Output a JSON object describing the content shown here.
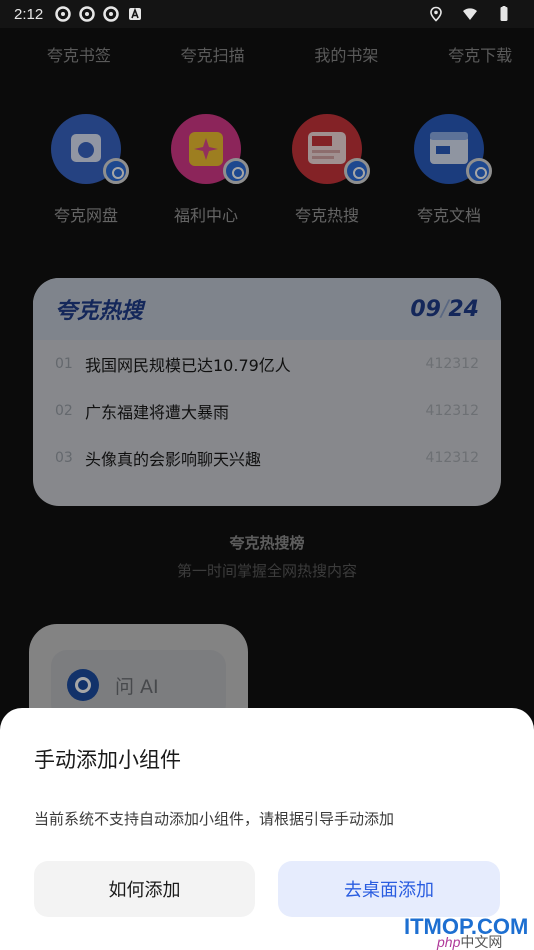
{
  "status_bar": {
    "time": "2:12"
  },
  "top_row": [
    "夸克书签",
    "夸克扫描",
    "我的书架",
    "夸克下载"
  ],
  "apps": [
    {
      "label": "夸克网盘",
      "icon": "cloud-drive-icon",
      "color": "#3a66c6"
    },
    {
      "label": "福利中心",
      "icon": "gift-star-icon",
      "color": "#d83a8a"
    },
    {
      "label": "夸克热搜",
      "icon": "hot-search-icon",
      "color": "#c9353b"
    },
    {
      "label": "夸克文档",
      "icon": "document-icon",
      "color": "#2a5cc0"
    }
  ],
  "hot_card": {
    "brand": "夸克热搜",
    "date_month": "09",
    "date_sep": "/",
    "date_day": "24",
    "items": [
      {
        "num": "01",
        "text": "我国网民规模已达10.79亿人",
        "score": "412312"
      },
      {
        "num": "02",
        "text": "广东福建将遭大暴雨",
        "score": "412312"
      },
      {
        "num": "03",
        "text": "头像真的会影响聊天兴趣",
        "score": "412312"
      }
    ]
  },
  "hot_caption": {
    "title": "夸克热搜榜",
    "subtitle": "第一时间掌握全网热搜内容"
  },
  "ai_card": {
    "label": "问 AI"
  },
  "sheet": {
    "title": "手动添加小组件",
    "description": "当前系统不支持自动添加小组件，请根据引导手动添加",
    "how_button": "如何添加",
    "add_button": "去桌面添加"
  },
  "watermark": {
    "main": "ITMOP.COM",
    "sub_php": "php",
    "sub_cn": "中文网"
  }
}
